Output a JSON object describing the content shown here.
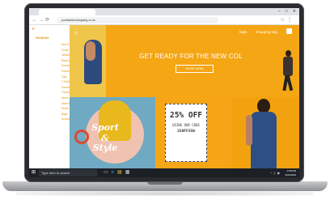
{
  "browser": {
    "url": "yourfashionshopping.co.uk",
    "window_controls": [
      "–",
      "□",
      "✕"
    ],
    "nav_buttons": [
      "←",
      "→",
      "⟳"
    ],
    "address_icons": [
      "☆",
      "⋮"
    ]
  },
  "sidebar": {
    "close_symbol": "×",
    "title": "WOMAN",
    "items": [
      "New In",
      "Coats",
      "Jackets",
      "Blazers",
      "Dresses",
      "Knitwear",
      "Tops",
      "T-Shirts",
      "Sweatshirts",
      "Trousers",
      "Jeans",
      "Skirts/Shorts",
      "Shoes",
      "Bags",
      "Accessories"
    ]
  },
  "hero": {
    "search_symbol": "⌕",
    "login_label": "login",
    "bag_label": "shopping bag",
    "headline": "GET READY FOR THE NEW COL",
    "cta_label": "SHOP NOW"
  },
  "promo": {
    "sport_line1": "Sport",
    "sport_line2": "&",
    "sport_line3": "Style",
    "discount": "25% OFF",
    "coupon_text": "USING OUR CODE",
    "coupon_code": "25OFF25W"
  },
  "taskbar": {
    "start_symbol": "⊞",
    "search_placeholder": "Type here to search",
    "app_icons": [
      "▭",
      "e",
      "▤",
      "▦"
    ],
    "tray_icons": [
      "^",
      "▯",
      "◉"
    ],
    "time": "2:48 PM",
    "date": "5/22/2019"
  },
  "colors": {
    "accent_orange": "#f5a614",
    "sidebar_text": "#e8930c",
    "taskbar": "#1c1f24",
    "edge_blue": "#3c8ce6"
  }
}
